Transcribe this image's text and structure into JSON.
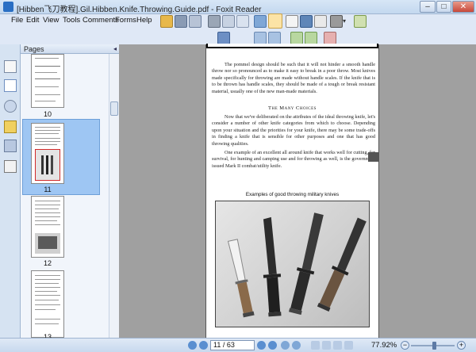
{
  "window": {
    "title": "[Hibben飞刀教程].Gil.Hibben.Knife.Throwing.Guide.pdf - Foxit Reader",
    "controls": {
      "minimize": "–",
      "maximize": "□",
      "close": "✕"
    }
  },
  "menu": {
    "items": [
      "File",
      "Edit",
      "View",
      "Tools",
      "Comments",
      "Forms",
      "Help"
    ]
  },
  "toolbar": {
    "icons": [
      "open-folder-icon",
      "save-icon",
      "print-icon",
      "hand-tool-icon",
      "select-text-icon",
      "snapshot-icon",
      "typewriter-icon"
    ]
  },
  "panel": {
    "title": "Pages",
    "collapse_glyph": "◂",
    "thumbnails": [
      {
        "label": "10"
      },
      {
        "label": "11",
        "selected": true
      },
      {
        "label": "12"
      },
      {
        "label": "13"
      }
    ]
  },
  "document": {
    "para1": "The pommel design should be such that it will not hinder a smooth handle throw nor so pronounced as to make it easy to break in a poor throw. Most knives made specifically for throwing are made without handle scales. If the knife that is to be thrown has handle scales, they should be made of a tough or break resistant material, usually one of the new man-made materials.",
    "heading": "The Many Choices",
    "para2": "Now that we've deliberated on the attributes of the ideal throwing knife, let's consider a number of other knife categories from which to choose. Depending upon your situation and the priorities for your knife, there may be some trade-offs in finding a knife that is sensible for other purposes and one that has good throwing qualities.",
    "para3": "One example of an excellent all around knife that works well for cutting, for survival, for hunting and camping use and for throwing as well, is the government issued Mark II combat/utility knife.",
    "caption": "Examples of good throwing military knives"
  },
  "statusbar": {
    "page_value": "11 / 63",
    "zoom": "77.92%",
    "zoom_minus": "−",
    "zoom_plus": "+",
    "page_fraction": 0.175
  },
  "colors": {
    "accent": "#3a7bd5",
    "selection": "#9ec6f3"
  }
}
